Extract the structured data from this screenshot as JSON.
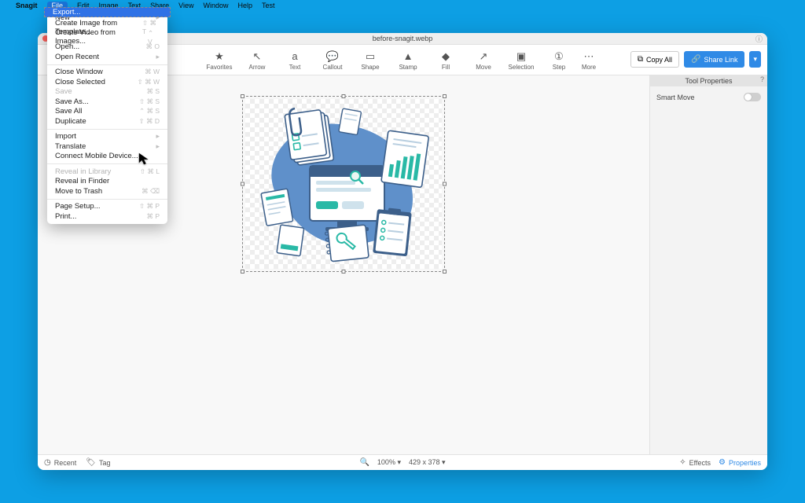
{
  "menubar": {
    "appname": "Snagit",
    "items": [
      "File",
      "Edit",
      "Image",
      "Text",
      "Share",
      "View",
      "Window",
      "Help",
      "Test"
    ],
    "open_index": 0
  },
  "window": {
    "title": "before-snagit.webp"
  },
  "toolbar": {
    "tools": [
      {
        "id": "favorites",
        "label": "Favorites",
        "glyph": "★"
      },
      {
        "id": "arrow",
        "label": "Arrow",
        "glyph": "↖"
      },
      {
        "id": "text",
        "label": "Text",
        "glyph": "a"
      },
      {
        "id": "callout",
        "label": "Callout",
        "glyph": "💬"
      },
      {
        "id": "shape",
        "label": "Shape",
        "glyph": "▭"
      },
      {
        "id": "stamp",
        "label": "Stamp",
        "glyph": "▲"
      },
      {
        "id": "fill",
        "label": "Fill",
        "glyph": "◆"
      },
      {
        "id": "move",
        "label": "Move",
        "glyph": "↗"
      },
      {
        "id": "selection",
        "label": "Selection",
        "glyph": "▣"
      },
      {
        "id": "step",
        "label": "Step",
        "glyph": "①"
      }
    ],
    "more": "More",
    "copy_all": "Copy All",
    "share_link": "Share Link"
  },
  "sidebar": {
    "title": "Tool Properties",
    "smart_move": "Smart Move"
  },
  "statusbar": {
    "recent": "Recent",
    "tag": "Tag",
    "zoom": "100% ▾",
    "dims": "429 x 378 ▾",
    "effects": "Effects",
    "properties": "Properties"
  },
  "file_menu": [
    {
      "label": "New",
      "type": "sub"
    },
    {
      "label": "Create Image from Template...",
      "shortcut": "⇧ ⌘ T"
    },
    {
      "label": "Create Video from Images...",
      "shortcut": "⌃ V"
    },
    {
      "label": "Open...",
      "shortcut": "⌘ O"
    },
    {
      "label": "Open Recent",
      "type": "sub"
    },
    {
      "type": "sep"
    },
    {
      "label": "Close Window",
      "shortcut": "⌘ W"
    },
    {
      "label": "Close Selected",
      "shortcut": "⇧ ⌘ W"
    },
    {
      "label": "Save",
      "shortcut": "⌘ S",
      "disabled": true
    },
    {
      "label": "Save As...",
      "shortcut": "⇧ ⌘ S"
    },
    {
      "label": "Save All",
      "shortcut": "⌃ ⌘ S"
    },
    {
      "label": "Duplicate",
      "shortcut": "⇧ ⌘ D"
    },
    {
      "type": "sep"
    },
    {
      "label": "Import",
      "type": "sub"
    },
    {
      "label": "Export...",
      "selected": true
    },
    {
      "label": "Translate",
      "type": "sub"
    },
    {
      "label": "Connect Mobile Device..."
    },
    {
      "type": "sep"
    },
    {
      "label": "Reveal in Library",
      "shortcut": "⇧ ⌘ L",
      "disabled": true
    },
    {
      "label": "Reveal in Finder"
    },
    {
      "label": "Move to Trash",
      "shortcut": "⌘ ⌫"
    },
    {
      "type": "sep"
    },
    {
      "label": "Page Setup...",
      "shortcut": "⇧ ⌘ P"
    },
    {
      "label": "Print...",
      "shortcut": "⌘ P"
    }
  ]
}
